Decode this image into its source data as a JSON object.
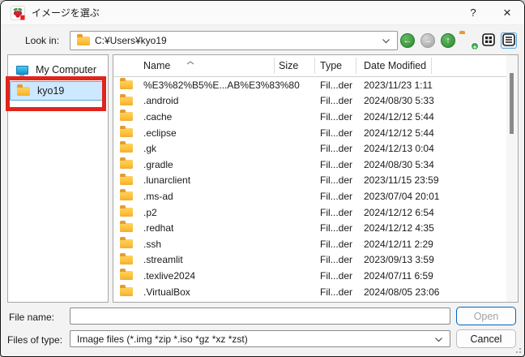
{
  "window": {
    "title": "イメージを選ぶ",
    "help_label": "?",
    "close_label": "×"
  },
  "toolbar": {
    "look_in_label": "Look in:",
    "path": "C:¥Users¥kyo19",
    "icons": {
      "back": "back-arrow",
      "forward": "forward-arrow",
      "up": "up-arrow",
      "new_folder": "new-folder",
      "icon_view": "icon-view-toggle",
      "detail_view": "detail-view-toggle"
    },
    "back_glyph": "←",
    "forward_glyph": "→",
    "up_glyph": "↑",
    "plus_glyph": "+"
  },
  "sidebar": {
    "items": [
      {
        "label": "My Computer",
        "icon": "computer",
        "selected": false
      },
      {
        "label": "kyo19",
        "icon": "folder",
        "selected": true
      }
    ],
    "annotation_color": "#e1241c"
  },
  "list": {
    "columns": [
      "Name",
      "Size",
      "Type",
      "Date Modified"
    ],
    "sort_column": "Name",
    "sort_order": "asc",
    "rows": [
      {
        "name": "%E3%82%B5%E...AB%E3%83%80",
        "size": "",
        "type": "Fil...der",
        "date": "2023/11/23 1:11"
      },
      {
        "name": ".android",
        "size": "",
        "type": "Fil...der",
        "date": "2024/08/30 5:33"
      },
      {
        "name": ".cache",
        "size": "",
        "type": "Fil...der",
        "date": "2024/12/12 5:44"
      },
      {
        "name": ".eclipse",
        "size": "",
        "type": "Fil...der",
        "date": "2024/12/12 5:44"
      },
      {
        "name": ".gk",
        "size": "",
        "type": "Fil...der",
        "date": "2024/12/13 0:04"
      },
      {
        "name": ".gradle",
        "size": "",
        "type": "Fil...der",
        "date": "2024/08/30 5:34"
      },
      {
        "name": ".lunarclient",
        "size": "",
        "type": "Fil...der",
        "date": "2023/11/15 23:59"
      },
      {
        "name": ".ms-ad",
        "size": "",
        "type": "Fil...der",
        "date": "2023/07/04 20:01"
      },
      {
        "name": ".p2",
        "size": "",
        "type": "Fil...der",
        "date": "2024/12/12 6:54"
      },
      {
        "name": ".redhat",
        "size": "",
        "type": "Fil...der",
        "date": "2024/12/12 4:35"
      },
      {
        "name": ".ssh",
        "size": "",
        "type": "Fil...der",
        "date": "2024/12/11 2:29"
      },
      {
        "name": ".streamlit",
        "size": "",
        "type": "Fil...der",
        "date": "2023/09/13 3:59"
      },
      {
        "name": ".texlive2024",
        "size": "",
        "type": "Fil...der",
        "date": "2024/07/11 6:59"
      },
      {
        "name": ".VirtualBox",
        "size": "",
        "type": "Fil...der",
        "date": "2024/08/05 23:06"
      }
    ]
  },
  "footer": {
    "file_name_label": "File name:",
    "file_name_value": "",
    "open_label": "Open",
    "files_of_type_label": "Files of type:",
    "files_of_type_value": "Image files (*.img *zip *.iso *gz *xz *zst)",
    "cancel_label": "Cancel"
  },
  "colors": {
    "selection_bg": "#cde8ff",
    "selection_border": "#5fa8dc",
    "annotation_red": "#e1241c",
    "open_button_border": "#0067c0",
    "folder_yellow": "#fdc13e",
    "nav_green": "#2f8a33",
    "nav_gray": "#a2a2a2"
  }
}
